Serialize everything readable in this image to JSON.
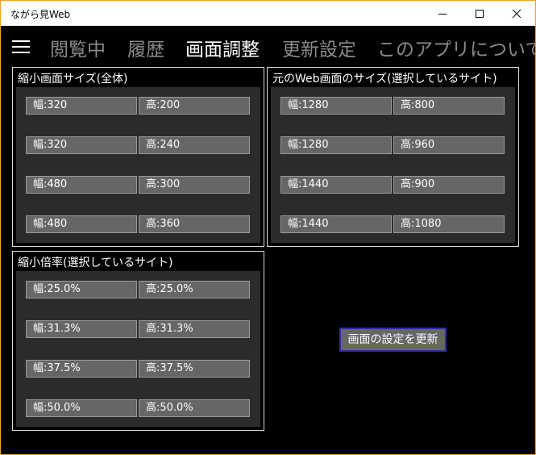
{
  "window": {
    "title": "ながら見Web"
  },
  "nav": {
    "menu_icon": "hamburger-icon",
    "tabs": [
      {
        "label": "閲覧中",
        "active": false
      },
      {
        "label": "履歴",
        "active": false
      },
      {
        "label": "画面調整",
        "active": true
      },
      {
        "label": "更新設定",
        "active": false
      },
      {
        "label": "このアプリについて",
        "active": false
      }
    ]
  },
  "panels": {
    "thumb_size": {
      "title": "縮小画面サイズ(全体)",
      "rows": [
        {
          "w": "幅:320",
          "h": "高:200"
        },
        {
          "w": "幅:320",
          "h": "高:240"
        },
        {
          "w": "幅:480",
          "h": "高:300"
        },
        {
          "w": "幅:480",
          "h": "高:360"
        }
      ]
    },
    "web_size": {
      "title": "元のWeb画面のサイズ(選択しているサイト)",
      "rows": [
        {
          "w": "幅:1280",
          "h": "高:800"
        },
        {
          "w": "幅:1280",
          "h": "高:960"
        },
        {
          "w": "幅:1440",
          "h": "高:900"
        },
        {
          "w": "幅:1440",
          "h": "高:1080"
        }
      ]
    },
    "scale": {
      "title": "縮小倍率(選択しているサイト)",
      "rows": [
        {
          "w": "幅:25.0%",
          "h": "高:25.0%"
        },
        {
          "w": "幅:31.3%",
          "h": "高:31.3%"
        },
        {
          "w": "幅:37.5%",
          "h": "高:37.5%"
        },
        {
          "w": "幅:50.0%",
          "h": "高:50.0%"
        }
      ]
    }
  },
  "update_button": {
    "label": "画面の設定を更新"
  },
  "colors": {
    "accent_border": "#f0a02c",
    "button_border": "#2c2ca8",
    "cell_bg": "#666666",
    "panel_bg": "#2b2b2b"
  }
}
